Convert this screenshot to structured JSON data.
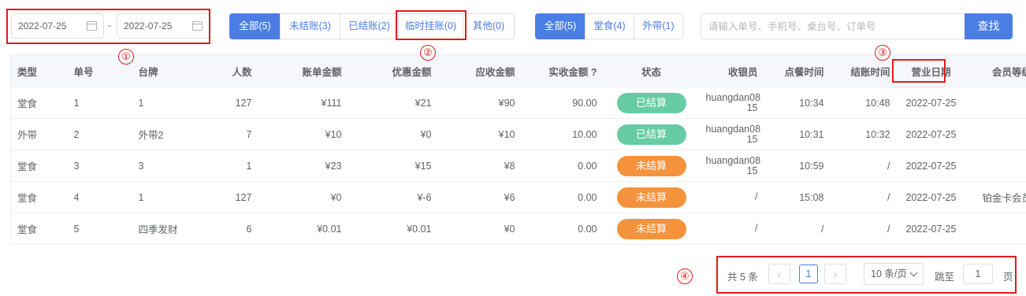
{
  "filters": {
    "start_date": "2022-07-25",
    "end_date": "2022-07-25",
    "date_separator": "-",
    "status_tabs": [
      {
        "label": "全部(5)",
        "active": true
      },
      {
        "label": "未结账(3)",
        "active": false
      },
      {
        "label": "已结账(2)",
        "active": false
      },
      {
        "label": "临时挂账(0)",
        "active": false
      },
      {
        "label": "其他(0)",
        "active": false
      }
    ],
    "type_tabs": [
      {
        "label": "全部(5)",
        "active": true
      },
      {
        "label": "堂食(4)",
        "active": false
      },
      {
        "label": "外带(1)",
        "active": false
      }
    ],
    "search_placeholder": "请输入单号、手机号、桌台号、订单号",
    "search_value": "",
    "search_button": "查找"
  },
  "annotations": [
    "①",
    "②",
    "③",
    "④"
  ],
  "table": {
    "headers": [
      "类型",
      "单号",
      "台牌",
      "人数",
      "账单金额",
      "优惠金额",
      "应收金额",
      "实收金额 ?",
      "状态",
      "收银员",
      "点餐时间",
      "结账时间",
      "营业日期",
      "会员等级"
    ],
    "rows": [
      {
        "type": "堂食",
        "no": "1",
        "table": "1",
        "people": "127",
        "bill": "¥111",
        "discount": "¥21",
        "receivable": "¥90",
        "received": "90.00",
        "status": "已结算",
        "status_kind": "done",
        "cashier": [
          "huangdan08",
          "15"
        ],
        "order_time": "10:34",
        "checkout_time": "10:48",
        "biz_date": "2022-07-25",
        "member": "/"
      },
      {
        "type": "外带",
        "no": "2",
        "table": "外带2",
        "people": "7",
        "bill": "¥10",
        "discount": "¥0",
        "receivable": "¥10",
        "received": "10.00",
        "status": "已结算",
        "status_kind": "done",
        "cashier": [
          "huangdan08",
          "15"
        ],
        "order_time": "10:31",
        "checkout_time": "10:32",
        "biz_date": "2022-07-25",
        "member": "/"
      },
      {
        "type": "堂食",
        "no": "3",
        "table": "3",
        "people": "1",
        "bill": "¥23",
        "discount": "¥15",
        "receivable": "¥8",
        "received": "0.00",
        "status": "未结算",
        "status_kind": "undone",
        "cashier": [
          "huangdan08",
          "15"
        ],
        "order_time": "10:59",
        "checkout_time": "/",
        "biz_date": "2022-07-25",
        "member": "/"
      },
      {
        "type": "堂食",
        "no": "4",
        "table": "1",
        "people": "127",
        "bill": "¥0",
        "discount": "¥-6",
        "receivable": "¥6",
        "received": "0.00",
        "status": "未结算",
        "status_kind": "undone",
        "cashier": [
          "/"
        ],
        "order_time": "15:08",
        "checkout_time": "/",
        "biz_date": "2022-07-25",
        "member": "铂金卡会员"
      },
      {
        "type": "堂食",
        "no": "5",
        "table": "四季发财",
        "people": "6",
        "bill": "¥0.01",
        "discount": "¥0.01",
        "receivable": "¥0",
        "received": "0.00",
        "status": "未结算",
        "status_kind": "undone",
        "cashier": [
          "/"
        ],
        "order_time": "/",
        "checkout_time": "/",
        "biz_date": "2022-07-25",
        "member": "/"
      }
    ]
  },
  "pagination": {
    "total_text": "共 5 条",
    "prev_icon": "‹",
    "next_icon": "›",
    "current_page": "1",
    "page_size": "10 条/页",
    "jump_label": "跳至",
    "jump_value": "1",
    "page_unit": "页"
  },
  "colors": {
    "primary": "#4b7ee5",
    "done": "#67cba5",
    "undone": "#f5923c",
    "highlight_box": "#e21b1b"
  }
}
